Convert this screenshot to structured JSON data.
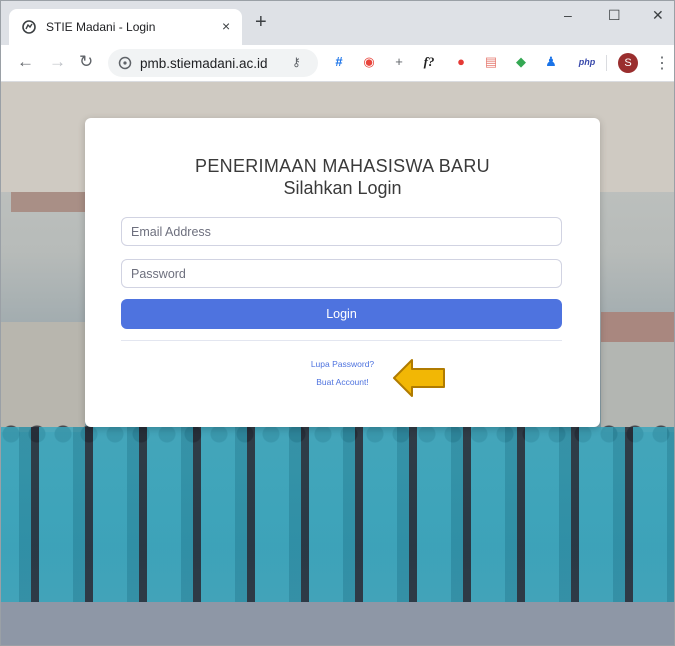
{
  "browser": {
    "tab_title": "STIE Madani - Login",
    "tab_close": "×",
    "new_tab": "+",
    "window_minimize": "–",
    "window_maximize": "☐",
    "window_close": "✕",
    "url": "pmb.stiemadani.ac.id",
    "avatar_letter": "S",
    "extensions": [
      "#",
      "◉",
      "+",
      "f?",
      "●",
      "▤",
      "◆",
      "♟",
      "php"
    ]
  },
  "login": {
    "heading": "PENERIMAAN MAHASISWA BARU",
    "subheading": "Silahkan Login",
    "email_placeholder": "Email Address",
    "password_placeholder": "Password",
    "login_button": "Login",
    "forgot_password": "Lupa Password?",
    "create_account": "Buat Account!"
  },
  "colors": {
    "primary": "#4e73df",
    "arrow": "#f2b705"
  }
}
